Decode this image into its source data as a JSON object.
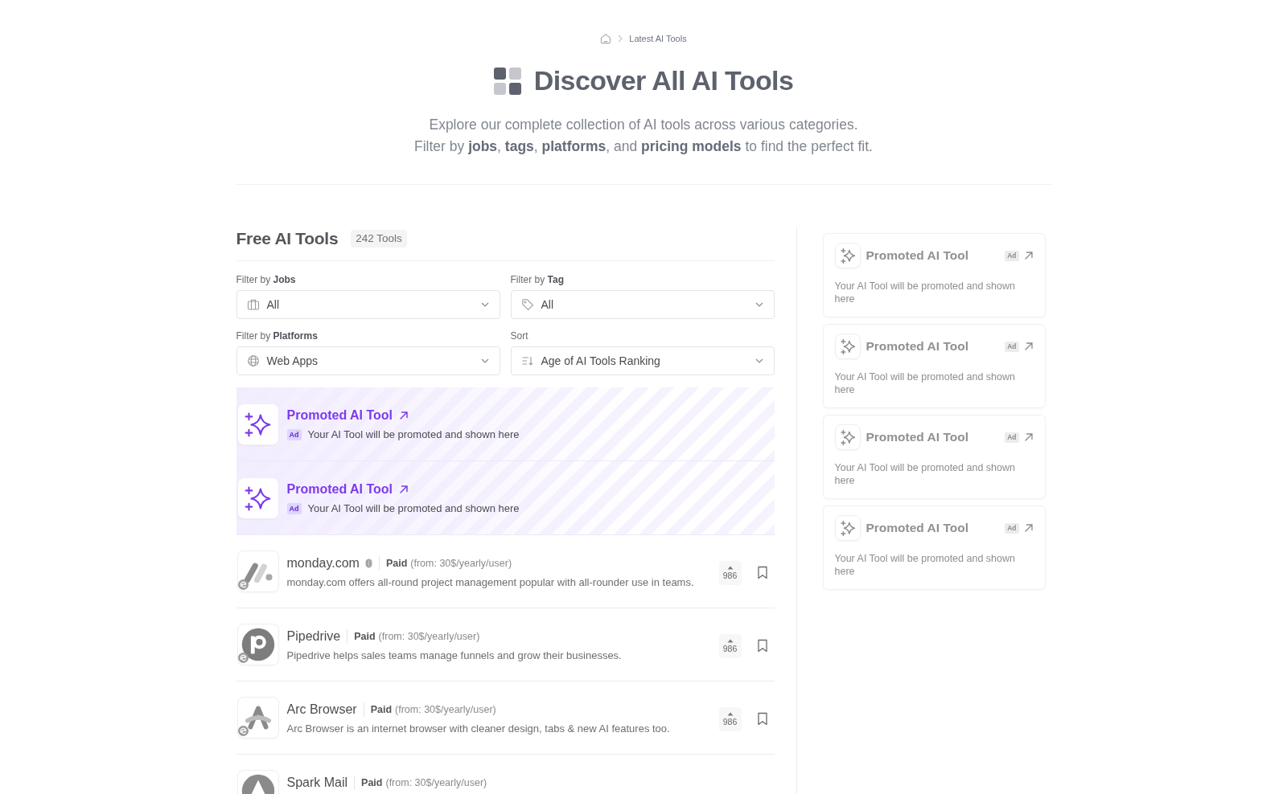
{
  "breadcrumb": {
    "current": "Latest AI Tools"
  },
  "hero": {
    "title": "Discover All AI Tools",
    "lines": [
      "Explore our complete collection of AI tools across various categories.",
      "Filter by **jobs**, **tags**, **platforms**, and **pricing models** to find the perfect fit."
    ]
  },
  "section": {
    "title": "Free AI Tools",
    "count": "242 Tools"
  },
  "filters": [
    {
      "kind": "jobs",
      "label": "Filter by **Jobs**",
      "value": "All"
    },
    {
      "kind": "tag",
      "label": "Filter by **Tag**",
      "value": "All"
    },
    {
      "kind": "platforms",
      "label": "Filter by **Platforms**",
      "value": "Web Apps"
    },
    {
      "kind": "sort",
      "label": "Sort",
      "value": "Age of AI Tools Ranking"
    }
  ],
  "promoted": [
    {
      "title": "Promoted AI Tool",
      "badge": "Ad",
      "description": "Your AI Tool will be promoted and shown here"
    },
    {
      "title": "Promoted AI Tool",
      "badge": "Ad",
      "description": "Your AI Tool will be promoted and shown here"
    }
  ],
  "tools": [
    {
      "kind": "slashes",
      "name": "monday.com",
      "verified": true,
      "pricing": "Paid",
      "price_detail": "(from: 30$/yearly/user)",
      "description": "monday.com offers all-round project management popular with all-rounder use in teams.",
      "votes": "986"
    },
    {
      "kind": "ring",
      "name": "Pipedrive",
      "verified": false,
      "pricing": "Paid",
      "price_detail": "(from: 30$/yearly/user)",
      "description": "Pipedrive helps sales teams manage funnels and grow their businesses.",
      "votes": "986"
    },
    {
      "kind": "arch",
      "name": "Arc Browser",
      "verified": false,
      "pricing": "Paid",
      "price_detail": "(from: 30$/yearly/user)",
      "description": "Arc Browser is an internet browser with cleaner design, tabs & new AI features too.",
      "votes": "986"
    },
    {
      "kind": "disc",
      "name": "Spark Mail",
      "verified": false,
      "pricing": "Paid",
      "price_detail": "(from: 30$/yearly/user)"
    }
  ],
  "sidebar_ads": [
    {
      "title": "Promoted AI Tool",
      "badge": "Ad",
      "description": "Your AI Tool will be promoted and shown here"
    },
    {
      "title": "Promoted AI Tool",
      "badge": "Ad",
      "description": "Your AI Tool will be promoted and shown here"
    },
    {
      "title": "Promoted AI Tool",
      "badge": "Ad",
      "description": "Your AI Tool will be promoted and shown here"
    },
    {
      "title": "Promoted AI Tool",
      "badge": "Ad",
      "description": "Your AI Tool will be promoted and shown here"
    }
  ]
}
